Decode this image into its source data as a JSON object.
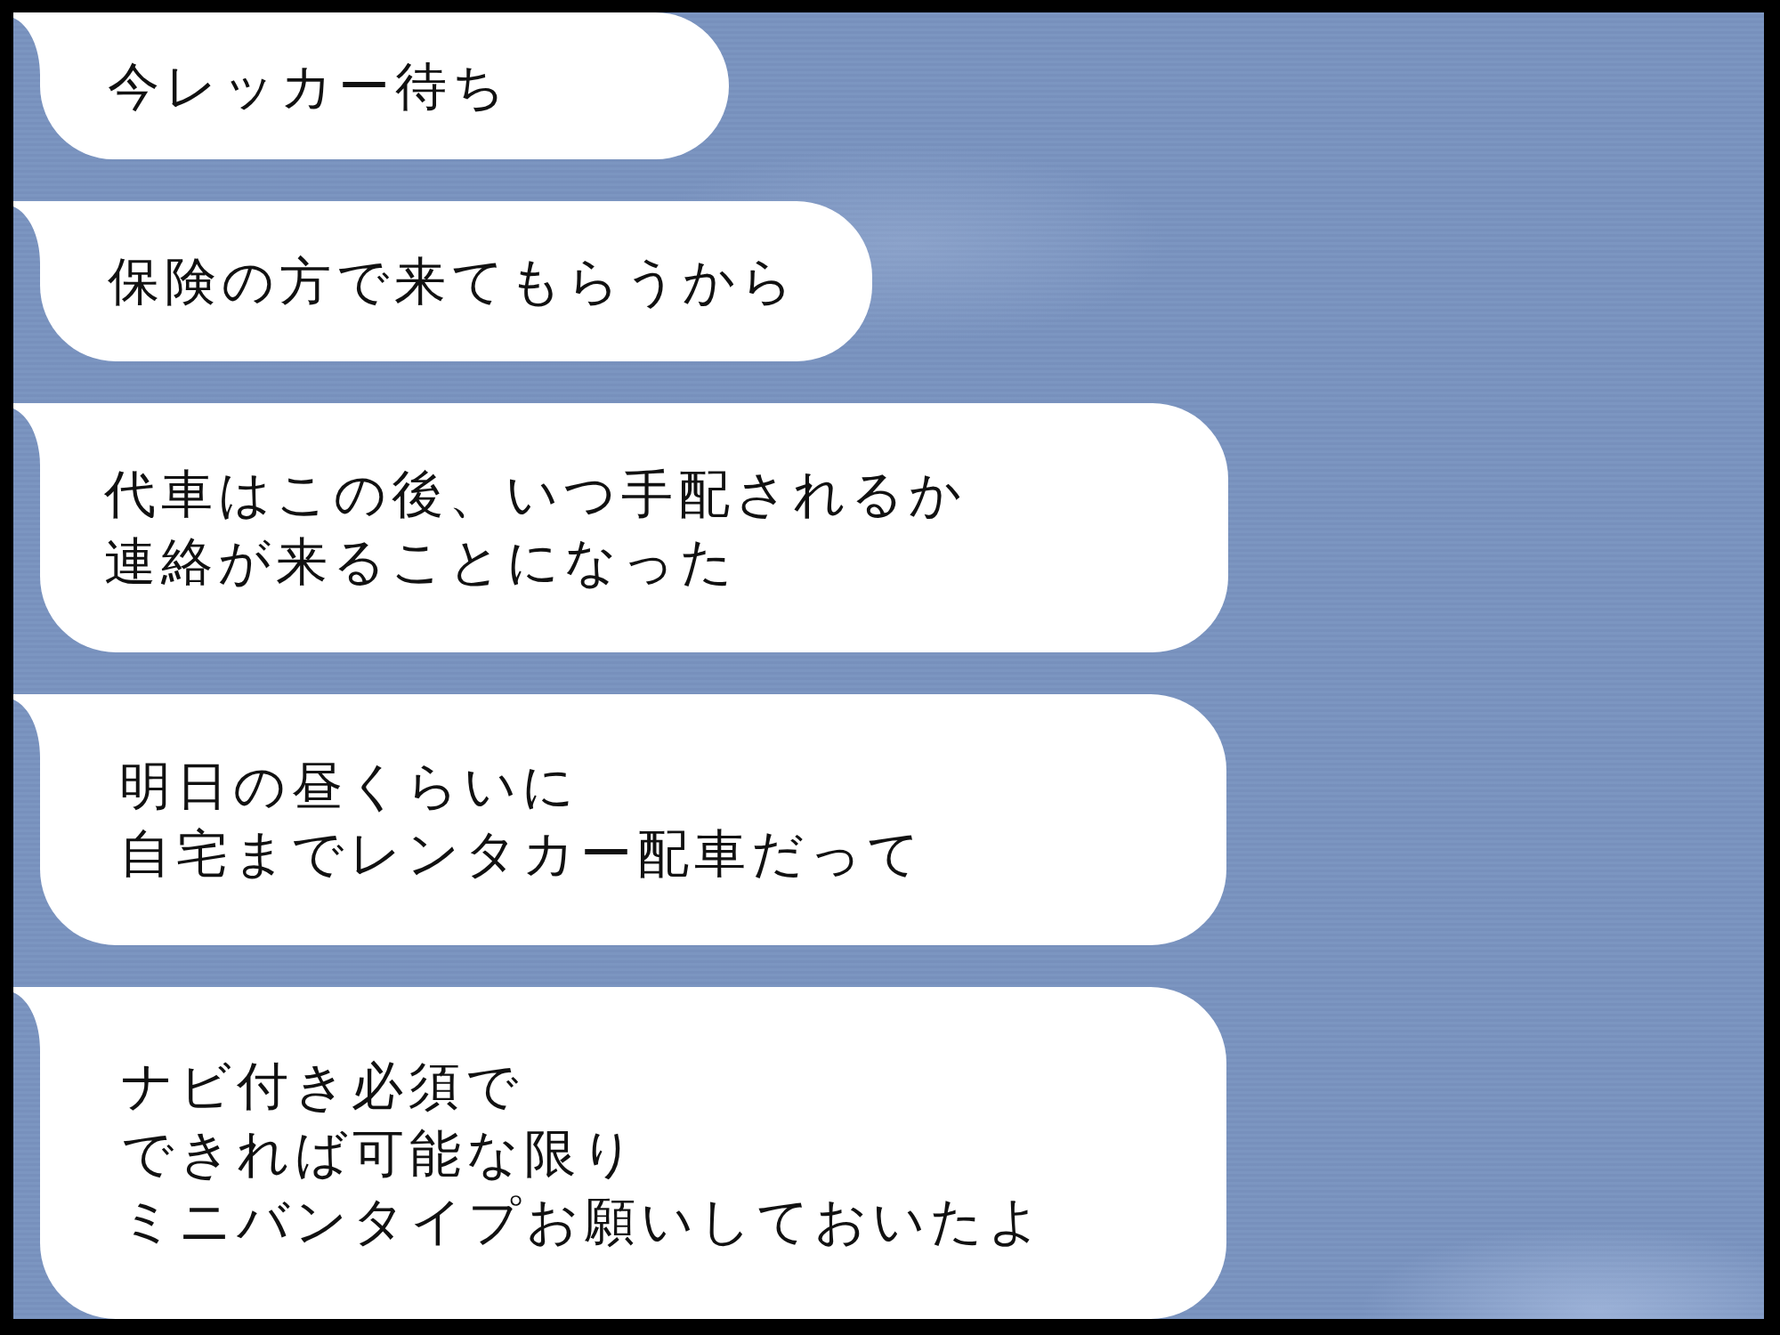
{
  "chat": {
    "messages": [
      {
        "lines": [
          "今レッカー待ち"
        ]
      },
      {
        "lines": [
          "保険の方で来てもらうから"
        ]
      },
      {
        "lines": [
          "代車はこの後、いつ手配されるか",
          "連絡が来ることになった"
        ]
      },
      {
        "lines": [
          "明日の昼くらいに",
          "自宅までレンタカー配車だって"
        ]
      },
      {
        "lines": [
          "ナビ付き必須で",
          "できれば可能な限り",
          "ミニバンタイプお願いしておいたよ"
        ]
      }
    ]
  }
}
